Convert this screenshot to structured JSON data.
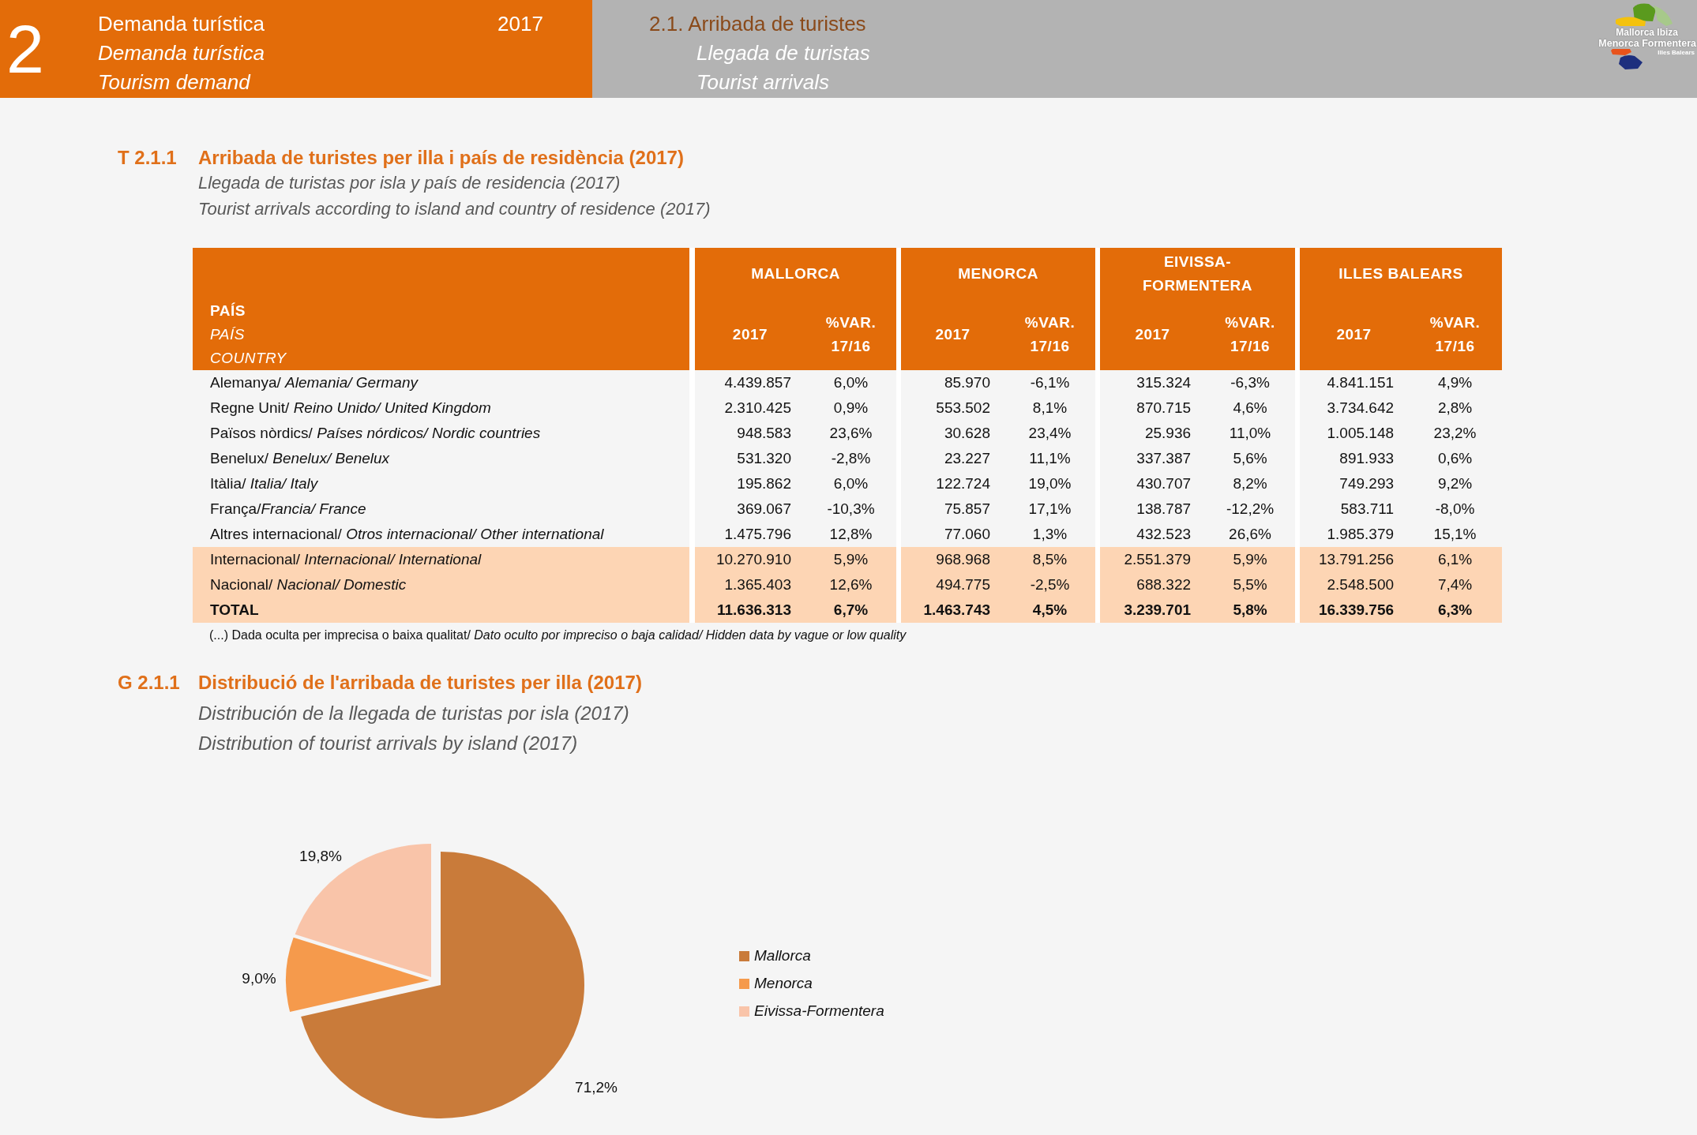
{
  "header": {
    "chapter_number": "2",
    "chapter_titles": [
      "Demanda turística",
      "Demanda turística",
      "Tourism demand"
    ],
    "year": "2017",
    "section_titles": [
      "2.1. Arribada de turistes",
      "Llegada de turistas",
      "Tourist arrivals"
    ],
    "logo_lines": [
      "Mallorca Ibiza",
      "Menorca Formentera",
      "Illes Balears"
    ]
  },
  "table_section": {
    "code": "T 2.1.1",
    "title": "Arribada de turistes per illa i país de residència (2017)",
    "subtitles": [
      "Llegada de turistas por isla y país de residencia (2017)",
      "Tourist arrivals according to island and country of residence (2017)"
    ]
  },
  "table": {
    "country_header": [
      "PAÍS",
      "PAÍS",
      "COUNTRY"
    ],
    "groups": [
      {
        "name": "MALLORCA",
        "columns": [
          "2017",
          "%VAR. 17/16"
        ]
      },
      {
        "name": "MENORCA",
        "columns": [
          "2017",
          "%VAR. 17/16"
        ]
      },
      {
        "name": "EIVISSA-FORMENTERA",
        "columns": [
          "2017",
          "%VAR. 17/16"
        ]
      },
      {
        "name": "ILLES BALEARS",
        "columns": [
          "2017",
          "%VAR. 17/16"
        ]
      }
    ],
    "rows": [
      {
        "kind": "country",
        "label": "Alemanya/ *Alemania/ Germany*",
        "cells": [
          "4.439.857",
          "6,0%",
          "85.970",
          "-6,1%",
          "315.324",
          "-6,3%",
          "4.841.151",
          "4,9%"
        ]
      },
      {
        "kind": "country",
        "label": "Regne Unit/ *Reino Unido/ United Kingdom*",
        "cells": [
          "2.310.425",
          "0,9%",
          "553.502",
          "8,1%",
          "870.715",
          "4,6%",
          "3.734.642",
          "2,8%"
        ]
      },
      {
        "kind": "country",
        "label": "Països nòrdics/ *Países nórdicos/ Nordic countries*",
        "cells": [
          "948.583",
          "23,6%",
          "30.628",
          "23,4%",
          "25.936",
          "11,0%",
          "1.005.148",
          "23,2%"
        ]
      },
      {
        "kind": "country",
        "label": "Benelux/ *Benelux/ Benelux*",
        "cells": [
          "531.320",
          "-2,8%",
          "23.227",
          "11,1%",
          "337.387",
          "5,6%",
          "891.933",
          "0,6%"
        ]
      },
      {
        "kind": "country",
        "label": "Itàlia/ *Italia/ Italy*",
        "cells": [
          "195.862",
          "6,0%",
          "122.724",
          "19,0%",
          "430.707",
          "8,2%",
          "749.293",
          "9,2%"
        ]
      },
      {
        "kind": "country",
        "label": "França/*Francia/ France*",
        "cells": [
          "369.067",
          "-10,3%",
          "75.857",
          "17,1%",
          "138.787",
          "-12,2%",
          "583.711",
          "-8,0%"
        ]
      },
      {
        "kind": "country",
        "label": "Altres internacional/ *Otros internacional/ Other international*",
        "cells": [
          "1.475.796",
          "12,8%",
          "77.060",
          "1,3%",
          "432.523",
          "26,6%",
          "1.985.379",
          "15,1%"
        ]
      },
      {
        "kind": "subtotal",
        "label": "Internacional/ *Internacional/ International*",
        "cells": [
          "10.270.910",
          "5,9%",
          "968.968",
          "8,5%",
          "2.551.379",
          "5,9%",
          "13.791.256",
          "6,1%"
        ]
      },
      {
        "kind": "subtotal",
        "label": "Nacional/ *Nacional/ Domestic*",
        "cells": [
          "1.365.403",
          "12,6%",
          "494.775",
          "-2,5%",
          "688.322",
          "5,5%",
          "2.548.500",
          "7,4%"
        ]
      },
      {
        "kind": "total",
        "label": "TOTAL",
        "cells": [
          "11.636.313",
          "6,7%",
          "1.463.743",
          "4,5%",
          "3.239.701",
          "5,8%",
          "16.339.756",
          "6,3%"
        ]
      }
    ]
  },
  "note": "(...) Dada oculta per imprecisa o baixa qualitat/ *Dato oculto por impreciso o baja calidad/ Hidden data by vague or low quality*",
  "chart_section": {
    "code": "G 2.1.1",
    "title": "Distribució de l'arribada de turistes per illa (2017)",
    "subtitles": [
      "Distribución de la llegada de turistas por isla (2017)",
      "Distribution of tourist arrivals by island (2017)"
    ],
    "chart_data": {
      "type": "pie",
      "categories": [
        "Mallorca",
        "Menorca",
        "Eivissa-Formentera"
      ],
      "values": [
        71.2,
        9.0,
        19.8
      ],
      "colors": [
        "#c97b3a",
        "#f59a4c",
        "#f9c4a9"
      ],
      "value_labels": [
        "71,2%",
        "9,0%",
        "19,8%"
      ],
      "legend": "right"
    }
  }
}
